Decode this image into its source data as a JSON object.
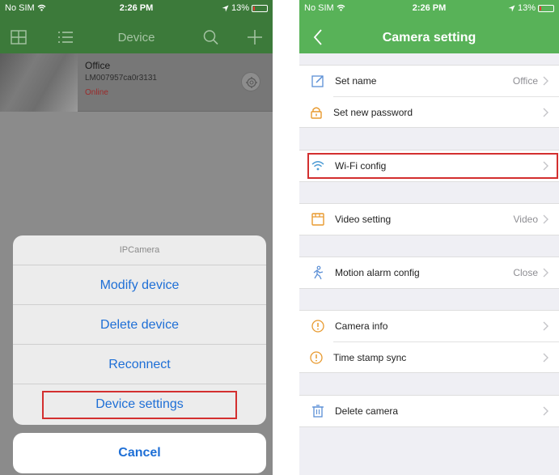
{
  "left": {
    "status": {
      "carrier": "No SIM",
      "time": "2:26 PM",
      "battery": "13%",
      "battery_level": 0.13
    },
    "header": {
      "title": "Device"
    },
    "device": {
      "name": "Office",
      "id": "LM007957ca0r3131",
      "status": "Online"
    },
    "sheet": {
      "title": "IPCamera",
      "items": [
        "Modify device",
        "Delete device",
        "Reconnect",
        "Device settings"
      ],
      "cancel": "Cancel"
    }
  },
  "right": {
    "status": {
      "carrier": "No SIM",
      "time": "2:26 PM",
      "battery": "13%",
      "battery_level": 0.13
    },
    "header": {
      "title": "Camera setting"
    },
    "rows": {
      "set_name": {
        "label": "Set name",
        "value": "Office"
      },
      "set_password": {
        "label": "Set new password"
      },
      "wifi": {
        "label": "Wi-Fi config"
      },
      "video": {
        "label": "Video setting",
        "value": "Video"
      },
      "motion": {
        "label": "Motion alarm config",
        "value": "Close"
      },
      "camera_info": {
        "label": "Camera info"
      },
      "timestamp": {
        "label": "Time stamp sync"
      },
      "delete": {
        "label": "Delete camera"
      }
    }
  },
  "colors": {
    "header_green": "#58b258",
    "accent_blue": "#1e6fd6",
    "highlight_red": "#d32f2f",
    "status_red": "#9b2a2a"
  },
  "icons": [
    "wifi-icon",
    "battery-icon",
    "grid-view-icon",
    "list-view-icon",
    "search-icon",
    "add-icon",
    "gear-icon",
    "back-chevron-icon",
    "edit-icon",
    "lock-icon",
    "video-icon",
    "motion-icon",
    "info-icon",
    "trash-icon",
    "chevron-right-icon"
  ]
}
